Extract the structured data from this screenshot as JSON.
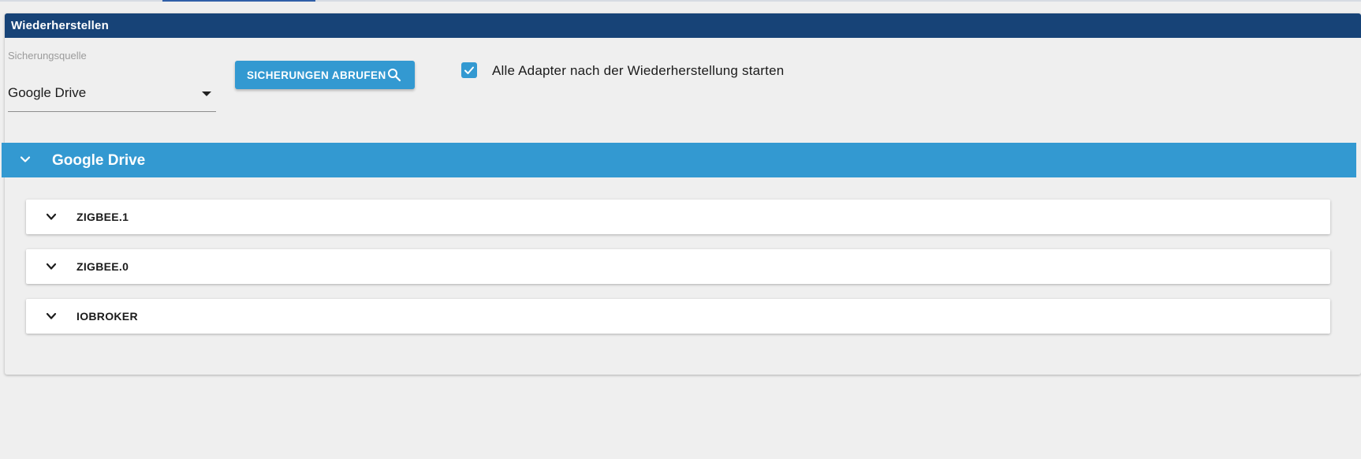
{
  "panel": {
    "title": "Wiederherstellen"
  },
  "source": {
    "label": "Sicherungsquelle",
    "value": "Google Drive"
  },
  "fetch_button": {
    "label": "SICHERUNGEN ABRUFEN",
    "icon": "search-icon"
  },
  "restart_option": {
    "checked": true,
    "label": "Alle Adapter nach der Wiederherstellung starten"
  },
  "accordion": {
    "title": "Google Drive",
    "items": [
      {
        "label": "ZIGBEE.1"
      },
      {
        "label": "ZIGBEE.0"
      },
      {
        "label": "IOBROKER"
      }
    ]
  },
  "colors": {
    "header": "#174377",
    "accent": "#3399d1",
    "background": "#efefef"
  }
}
